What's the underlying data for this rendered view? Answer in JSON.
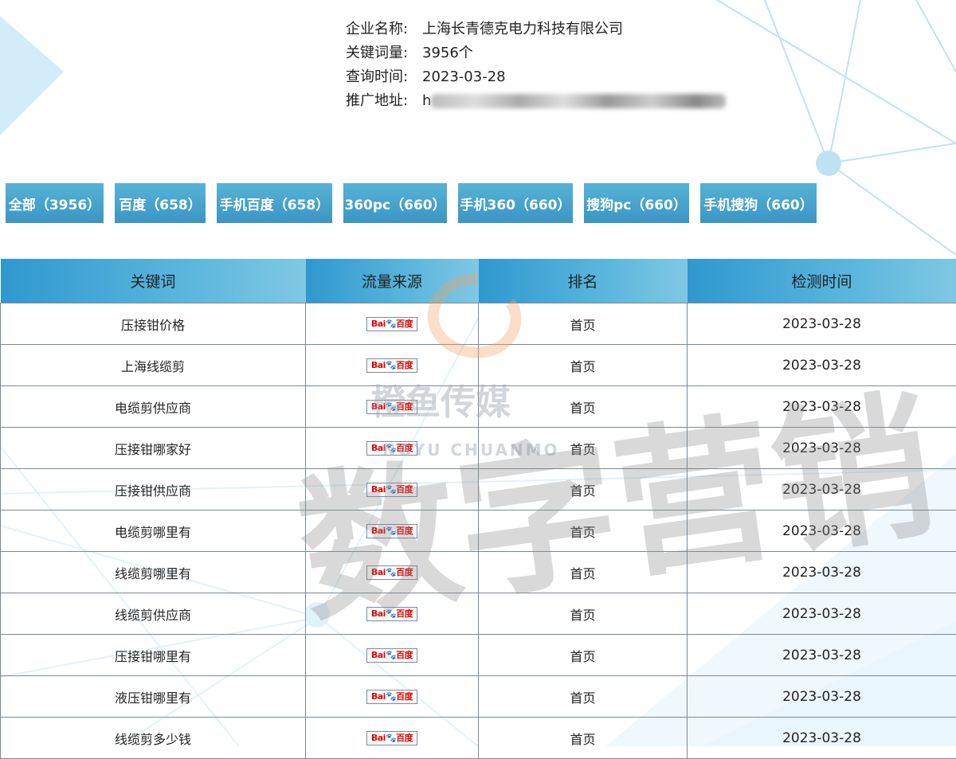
{
  "info": {
    "company_label": "企业名称:",
    "company_value": "上海长青德克电力科技有限公司",
    "keywords_label": "关键词量:",
    "keywords_value": "3956个",
    "query_label": "查询时间:",
    "query_value": "2023-03-28",
    "url_label": "推广地址:",
    "url_value": "h"
  },
  "tabs": [
    {
      "label": "全部（3956）"
    },
    {
      "label": "百度（658）"
    },
    {
      "label": "手机百度（658）"
    },
    {
      "label": "360pc（660）"
    },
    {
      "label": "手机360（660）"
    },
    {
      "label": "搜狗pc（660）"
    },
    {
      "label": "手机搜狗（660）"
    }
  ],
  "table": {
    "headers": [
      "关键词",
      "流量来源",
      "排名",
      "检测时间"
    ],
    "source_logo": {
      "left": "Bai",
      "paw": "🐾",
      "right": "百度"
    },
    "rows": [
      {
        "keyword": "压接钳价格",
        "rank": "首页",
        "date": "2023-03-28"
      },
      {
        "keyword": "上海线缆剪",
        "rank": "首页",
        "date": "2023-03-28"
      },
      {
        "keyword": "电缆剪供应商",
        "rank": "首页",
        "date": "2023-03-28"
      },
      {
        "keyword": "压接钳哪家好",
        "rank": "首页",
        "date": "2023-03-28"
      },
      {
        "keyword": "压接钳供应商",
        "rank": "首页",
        "date": "2023-03-28"
      },
      {
        "keyword": "电缆剪哪里有",
        "rank": "首页",
        "date": "2023-03-28"
      },
      {
        "keyword": "线缆剪哪里有",
        "rank": "首页",
        "date": "2023-03-28"
      },
      {
        "keyword": "线缆剪供应商",
        "rank": "首页",
        "date": "2023-03-28"
      },
      {
        "keyword": "压接钳哪里有",
        "rank": "首页",
        "date": "2023-03-28"
      },
      {
        "keyword": "液压钳哪里有",
        "rank": "首页",
        "date": "2023-03-28"
      },
      {
        "keyword": "线缆剪多少钱",
        "rank": "首页",
        "date": "2023-03-28"
      }
    ]
  },
  "watermark": {
    "brand_cn": "橙鱼传媒",
    "brand_en": "NGYU CHUANMO",
    "slogan": "数字营销"
  },
  "colors": {
    "tab_top": "#56b3d6",
    "tab_bottom": "#3b95c4",
    "header_left": "#2f98cf",
    "header_right": "#7fc8e3",
    "deco_blue": "#cfeaf8"
  }
}
